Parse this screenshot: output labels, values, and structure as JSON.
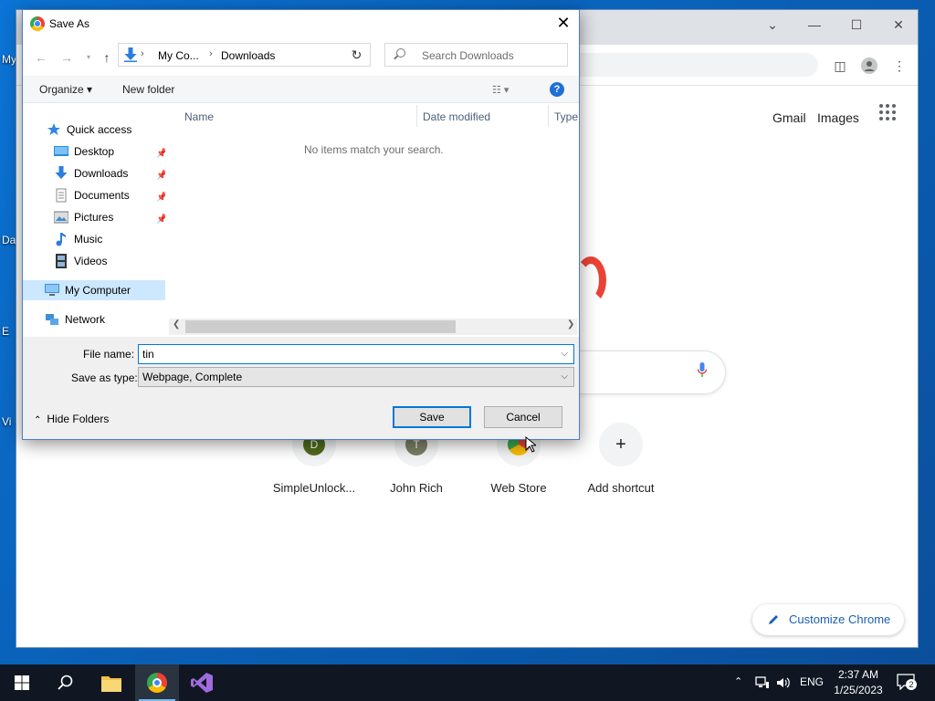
{
  "desktop": {
    "labels": [
      "My",
      "Da",
      "E",
      "Vi"
    ]
  },
  "chrome": {
    "header_links": {
      "gmail": "Gmail",
      "images": "Images"
    },
    "shortcuts": [
      {
        "letter": "D",
        "label": "SimpleUnlock...",
        "color": "#4f6b1c"
      },
      {
        "letter": "T",
        "label": "John Rich",
        "color": "#7b7f66"
      },
      {
        "letter": "",
        "label": "Web Store",
        "color": ""
      },
      {
        "letter": "+",
        "label": "Add shortcut",
        "color": ""
      }
    ],
    "customize_label": "Customize Chrome"
  },
  "dialog": {
    "title": "Save As",
    "address": {
      "crumbs": [
        "My Co...",
        "Downloads"
      ]
    },
    "search_placeholder": "Search Downloads",
    "toolbar": {
      "organize": "Organize ▾",
      "new_folder": "New folder"
    },
    "nav_tree": [
      {
        "label": "Quick access",
        "icon": "star-icon",
        "pinned": false
      },
      {
        "label": "Desktop",
        "icon": "desktop-folder-icon",
        "pinned": true
      },
      {
        "label": "Downloads",
        "icon": "download-icon",
        "pinned": true
      },
      {
        "label": "Documents",
        "icon": "documents-icon",
        "pinned": true
      },
      {
        "label": "Pictures",
        "icon": "pictures-icon",
        "pinned": true
      },
      {
        "label": "Music",
        "icon": "music-icon",
        "pinned": false
      },
      {
        "label": "Videos",
        "icon": "videos-icon",
        "pinned": false
      },
      {
        "label": "My Computer",
        "icon": "computer-icon",
        "pinned": false
      },
      {
        "label": "Network",
        "icon": "network-icon",
        "pinned": false
      }
    ],
    "columns": [
      "Name",
      "Date modified",
      "Type"
    ],
    "empty_message": "No items match your search.",
    "file_name_label": "File name:",
    "file_name_value": "tin",
    "save_type_label": "Save as type:",
    "save_type_value": "Webpage, Complete",
    "hide_folders": "Hide Folders",
    "save_button": "Save",
    "cancel_button": "Cancel"
  },
  "taskbar": {
    "language": "ENG",
    "time": "2:37 AM",
    "date": "1/25/2023",
    "notifications": "2"
  }
}
